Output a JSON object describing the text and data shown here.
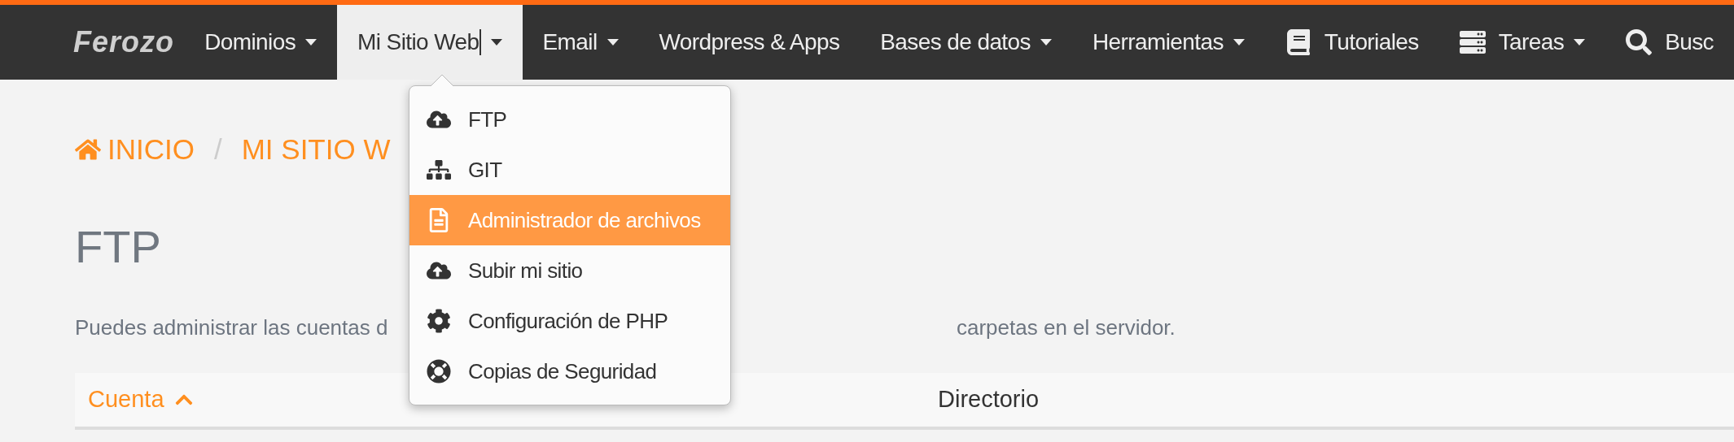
{
  "nav": {
    "logo": "Ferozo",
    "items": [
      {
        "label": "Dominios",
        "kind": "menu",
        "dropdown": true,
        "selected": false,
        "cursor": false
      },
      {
        "label": "Mi Sitio Web",
        "kind": "menu",
        "dropdown": true,
        "selected": true,
        "cursor": true
      },
      {
        "label": "Email",
        "kind": "menu",
        "dropdown": true,
        "selected": false,
        "cursor": false
      },
      {
        "label": "Wordpress & Apps",
        "kind": "menu",
        "dropdown": false,
        "selected": false,
        "cursor": false
      },
      {
        "label": "Bases de datos",
        "kind": "menu",
        "dropdown": true,
        "selected": false,
        "cursor": false
      },
      {
        "label": "Herramientas",
        "kind": "menu",
        "dropdown": true,
        "selected": false,
        "cursor": false
      },
      {
        "label": "Tutoriales",
        "kind": "book",
        "dropdown": false,
        "selected": false,
        "cursor": false
      },
      {
        "label": "Tareas",
        "kind": "server",
        "dropdown": true,
        "selected": false,
        "cursor": false
      },
      {
        "label": "Busc",
        "kind": "search",
        "dropdown": false,
        "selected": false,
        "cursor": false
      }
    ]
  },
  "dropdown": {
    "items": [
      {
        "label": "FTP",
        "kind": "upload",
        "selected": false
      },
      {
        "label": "GIT",
        "kind": "sitemap",
        "selected": false
      },
      {
        "label": "Administrador de archivos",
        "kind": "file",
        "selected": true
      },
      {
        "label": "Subir mi sitio",
        "kind": "upload",
        "selected": false
      },
      {
        "label": "Configuración de PHP",
        "kind": "settings",
        "selected": false
      },
      {
        "label": "Copias de Seguridad",
        "kind": "lifebuoy",
        "selected": false
      }
    ]
  },
  "breadcrumb": {
    "separator": "/",
    "items": [
      {
        "label": "INICIO",
        "kind": "home"
      },
      {
        "label": "MI SITIO W",
        "kind": "text"
      }
    ]
  },
  "heading": "FTP",
  "description": [
    "Puedes administrar las cuentas d",
    "carpetas en el servidor."
  ],
  "table": {
    "columns": [
      {
        "label": "Cuenta",
        "sorted": true
      },
      {
        "label": "Directorio",
        "sorted": false
      }
    ]
  }
}
